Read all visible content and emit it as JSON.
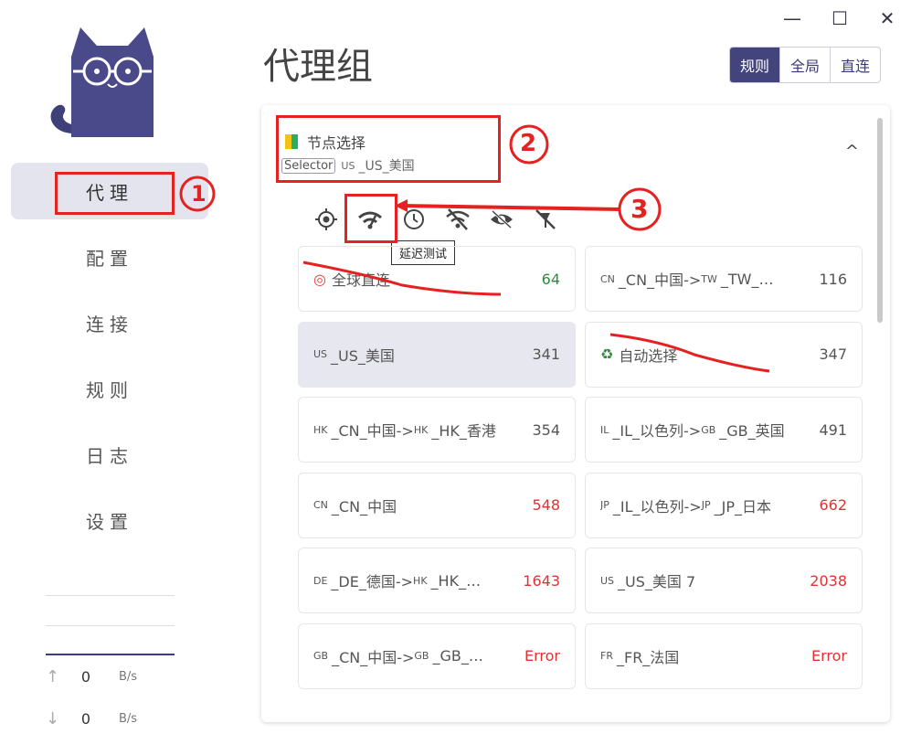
{
  "window": {
    "minimize": "—",
    "maximize": "☐",
    "close": "✕"
  },
  "sidebar": {
    "items": [
      {
        "label": "代理",
        "active": true
      },
      {
        "label": "配置"
      },
      {
        "label": "连接"
      },
      {
        "label": "规则"
      },
      {
        "label": "日志"
      },
      {
        "label": "设置"
      }
    ],
    "traffic": {
      "up": {
        "arrow": "↑",
        "value": "0",
        "unit": "B/s"
      },
      "down": {
        "arrow": "↓",
        "value": "0",
        "unit": "B/s"
      }
    }
  },
  "header": {
    "title": "代理组",
    "modes": [
      "规则",
      "全局",
      "直连"
    ],
    "active_mode": "规则"
  },
  "group": {
    "name": "节点选择",
    "type_tag": "Selector",
    "current_flag": "US",
    "current": "_US_美国",
    "tooltip": "延迟测试",
    "chevron": "^"
  },
  "nodes": [
    {
      "flag": "",
      "icon": "target",
      "name": "全球直连",
      "delay": "64",
      "delay_color": "green"
    },
    {
      "flag": "CN",
      "name": "_CN_中国->",
      "flag2": "TW",
      "name2": "_TW_…",
      "delay": "116",
      "delay_color": "normal"
    },
    {
      "flag": "US",
      "name": "_US_美国",
      "delay": "341",
      "delay_color": "normal",
      "selected": true
    },
    {
      "flag": "",
      "icon": "recycle",
      "name": "自动选择",
      "delay": "347",
      "delay_color": "normal"
    },
    {
      "flag": "HK",
      "name": "_CN_中国->",
      "flag2": "HK",
      "name2": "_HK_香港",
      "delay": "354",
      "delay_color": "normal"
    },
    {
      "flag": "IL",
      "name": "_IL_以色列->",
      "flag2": "GB",
      "name2": "_GB_英国",
      "delay": "491",
      "delay_color": "normal"
    },
    {
      "flag": "CN",
      "name": "_CN_中国",
      "delay": "548",
      "delay_color": "red"
    },
    {
      "flag": "JP",
      "name": "_IL_以色列->",
      "flag2": "JP",
      "name2": "_JP_日本",
      "delay": "662",
      "delay_color": "red"
    },
    {
      "flag": "DE",
      "name": "_DE_德国->",
      "flag2": "HK",
      "name2": "_HK_…",
      "delay": "1643",
      "delay_color": "red"
    },
    {
      "flag": "US",
      "name": "_US_美国 7",
      "delay": "2038",
      "delay_color": "red"
    },
    {
      "flag": "GB",
      "name": "_CN_中国->",
      "flag2": "GB",
      "name2": "_GB_…",
      "delay": "Error",
      "delay_color": "red"
    },
    {
      "flag": "FR",
      "name": "_FR_法国",
      "delay": "Error",
      "delay_color": "red"
    }
  ],
  "annotations": {
    "one": "1",
    "two": "2",
    "three": "3"
  },
  "colors": {
    "accent": "#44447d",
    "annotation": "#e52222",
    "delay_green": "#2e8b3e",
    "delay_red": "#d33333"
  }
}
